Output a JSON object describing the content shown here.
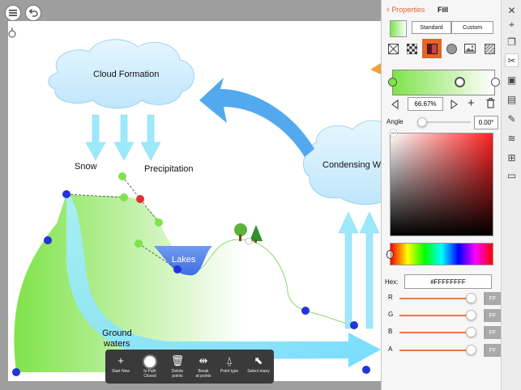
{
  "diagram": {
    "cloud_formation": "Cloud Formation",
    "condensing": "Condensing Wa",
    "snow": "Snow",
    "precipitation": "Precipitation",
    "lakes": "Lakes",
    "ground_waters_1": "Ground",
    "ground_waters_2": "waters"
  },
  "toolbar": {
    "start_new": "Start New",
    "is_path_closed_1": "Is Path",
    "is_path_closed_2": "Closed",
    "delete_points_1": "Delete",
    "delete_points_2": "points",
    "break_points_1": "Break",
    "break_points_2": "at points",
    "point_type": "Point type",
    "select_many": "Select many"
  },
  "panel": {
    "back_label": "Properties",
    "title": "Fill",
    "tab_standard": "Standard",
    "tab_custom": "Custom",
    "stop_position": "66.67%",
    "angle_label": "Angle",
    "angle_value": "0.00°",
    "hex_label": "Hex:",
    "hex_value": "#FFFFFFFF",
    "r_label": "R",
    "g_label": "G",
    "b_label": "B",
    "a_label": "A",
    "r_value": "FF",
    "g_value": "FF",
    "b_value": "FF",
    "a_value": "FF"
  },
  "colors": {
    "accent": "#e2652a",
    "gradient_start": "#7fe34a",
    "gradient_end": "#ffffff",
    "cloud": "#bfe6fb",
    "arrow": "#53a9ee"
  }
}
